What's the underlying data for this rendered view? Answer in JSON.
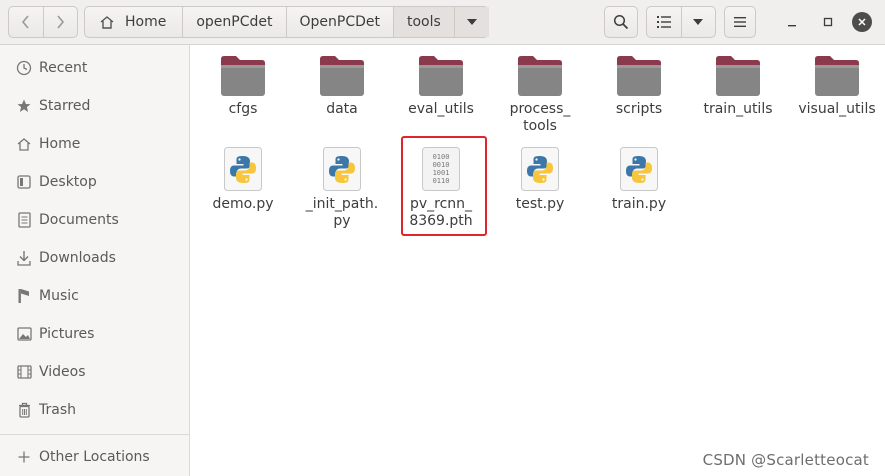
{
  "toolbar": {
    "back_icon": "chevron-left-icon",
    "forward_icon": "chevron-right-icon",
    "breadcrumb": [
      "Home",
      "openPCdet",
      "OpenPCDet",
      "tools"
    ],
    "search_icon": "search-icon",
    "view_icon": "list-view-icon",
    "view_dropdown_icon": "chevron-down-icon",
    "menu_icon": "hamburger-menu-icon"
  },
  "sidebar": {
    "items": [
      {
        "label": "Recent",
        "icon": "clock-icon"
      },
      {
        "label": "Starred",
        "icon": "star-icon"
      },
      {
        "label": "Home",
        "icon": "home-icon"
      },
      {
        "label": "Desktop",
        "icon": "desktop-icon"
      },
      {
        "label": "Documents",
        "icon": "documents-icon"
      },
      {
        "label": "Downloads",
        "icon": "download-icon"
      },
      {
        "label": "Music",
        "icon": "music-icon"
      },
      {
        "label": "Pictures",
        "icon": "pictures-icon"
      },
      {
        "label": "Videos",
        "icon": "videos-icon"
      },
      {
        "label": "Trash",
        "icon": "trash-icon"
      }
    ],
    "other_locations": {
      "label": "Other Locations",
      "icon": "plus-icon"
    }
  },
  "files": {
    "folders": [
      {
        "name": "cfgs"
      },
      {
        "name": "data"
      },
      {
        "name": "eval_utils"
      },
      {
        "name": "process_\ntools"
      },
      {
        "name": "scripts"
      },
      {
        "name": "train_utils"
      },
      {
        "name": "visual_utils"
      }
    ],
    "files": [
      {
        "name": "demo.py",
        "type": "python"
      },
      {
        "name": "_init_path.\npy",
        "type": "python"
      },
      {
        "name": "pv_rcnn_\n8369.pth",
        "type": "binary",
        "selected": true
      },
      {
        "name": "test.py",
        "type": "python"
      },
      {
        "name": "train.py",
        "type": "python"
      }
    ],
    "binary_glyph": [
      "0100",
      "0010",
      "1001",
      "0110"
    ]
  },
  "watermark": "CSDN @Scarletteocat",
  "colors": {
    "folder_top": "#8b3a4d",
    "folder_body": "#8a8a8a",
    "selection": "#e0252b"
  }
}
